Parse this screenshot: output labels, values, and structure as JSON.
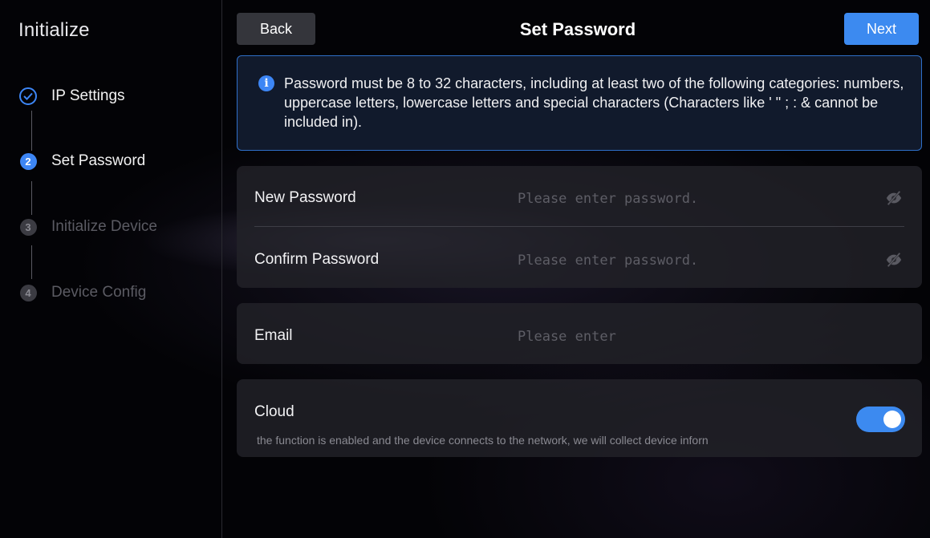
{
  "sidebar": {
    "title": "Initialize",
    "steps": [
      {
        "index": "1",
        "label": "IP Settings",
        "state": "done"
      },
      {
        "index": "2",
        "label": "Set Password",
        "state": "active"
      },
      {
        "index": "3",
        "label": "Initialize Device",
        "state": "todo"
      },
      {
        "index": "4",
        "label": "Device Config",
        "state": "todo"
      }
    ]
  },
  "header": {
    "back_label": "Back",
    "title": "Set Password",
    "next_label": "Next"
  },
  "info": {
    "icon": "info-icon",
    "text": "Password must be 8 to 32 characters, including at least two of the following categories: numbers, uppercase letters, lowercase letters and special characters (Characters like ' \" ; : & cannot be included in)."
  },
  "form": {
    "new_password": {
      "label": "New Password",
      "placeholder": "Please enter password.",
      "value": ""
    },
    "confirm_password": {
      "label": "Confirm Password",
      "placeholder": "Please enter password.",
      "value": ""
    },
    "email": {
      "label": "Email",
      "placeholder": "Please enter",
      "value": ""
    },
    "cloud": {
      "label": "Cloud",
      "description": "the function is enabled and the device connects to the network, we will collect device inforn",
      "enabled": true
    }
  },
  "colors": {
    "accent": "#3c8af0",
    "info_border": "#2f6fc9",
    "inactive_text": "#5b5b63"
  }
}
